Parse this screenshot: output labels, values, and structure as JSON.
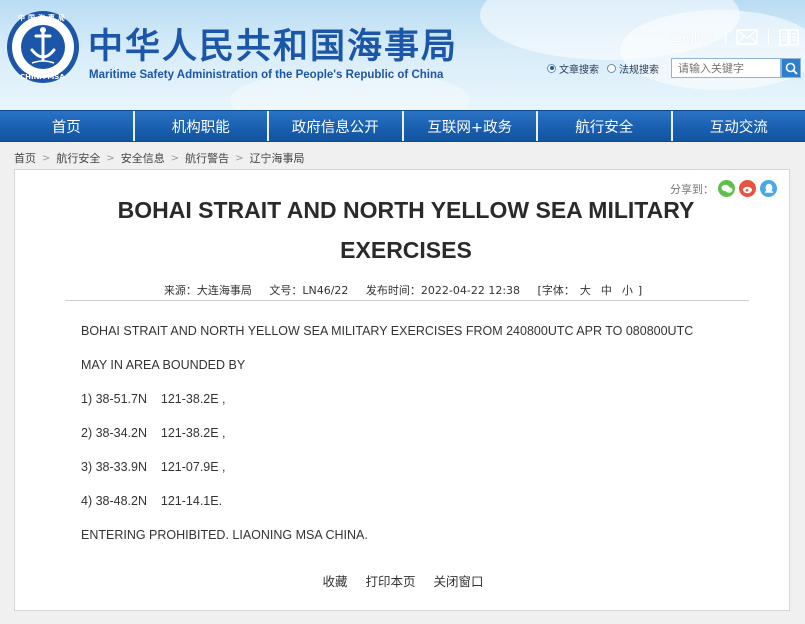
{
  "header": {
    "site_name_cn": "中华人民共和国海事局",
    "site_name_en": "Maritime Safety Administration of the People's Republic of China",
    "logo_text_top": "中国海事局",
    "logo_text_bottom": "CHINA MSA",
    "english_label": "English"
  },
  "search": {
    "option_article": "文章搜索",
    "option_law": "法规搜索",
    "placeholder": "请输入关键字"
  },
  "nav": {
    "items": [
      {
        "label": "首页"
      },
      {
        "label": "机构职能"
      },
      {
        "label": "政府信息公开"
      },
      {
        "label": "互联网+政务"
      },
      {
        "label": "航行安全"
      },
      {
        "label": "互动交流"
      }
    ]
  },
  "breadcrumb": {
    "items": [
      "首页",
      "航行安全",
      "安全信息",
      "航行警告",
      "辽宁海事局"
    ]
  },
  "article": {
    "share_label": "分享到：",
    "title": "BOHAI STRAIT AND NORTH YELLOW SEA MILITARY EXERCISES",
    "source": "来源：大连海事局",
    "doc_no": "文号：LN46/22",
    "publish_time": "发布时间：2022-04-22 12:38",
    "font_size_prefix": "[字体：",
    "size_large": "大",
    "size_medium": "中",
    "size_small": "小",
    "font_size_suffix": "]",
    "paragraphs": [
      "BOHAI STRAIT AND NORTH YELLOW SEA MILITARY EXERCISES FROM 240800UTC APR TO 080800UTC",
      "MAY IN AREA BOUNDED BY",
      "1) 38-51.7N    121-38.2E ,",
      "2) 38-34.2N    121-38.2E ,",
      "3) 38-33.9N    121-07.9E ,",
      "4) 38-48.2N    121-14.1E.",
      "ENTERING PROHIBITED. LIAONING MSA CHINA."
    ],
    "favorite_label": "收藏",
    "print_label": "打印本页",
    "close_label": "关闭窗口"
  },
  "colors": {
    "brand_blue": "#1c56a8",
    "nav_blue": "#1a5fb0",
    "wechat_green": "#5ec04b",
    "weibo_red": "#e8533f",
    "qq_blue": "#4aa8e6"
  }
}
